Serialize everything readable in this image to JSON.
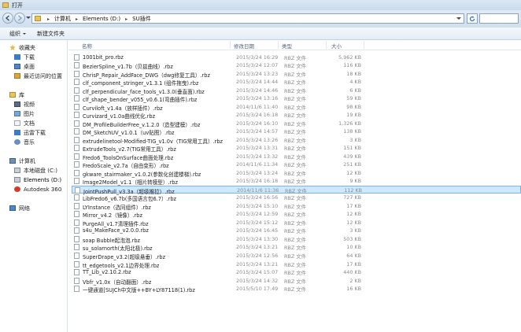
{
  "window": {
    "title": "打开"
  },
  "address": {
    "breadcrumb": [
      "计算机",
      "Elements (D:)",
      "SU插件"
    ]
  },
  "toolbar": {
    "organize": "组织",
    "new_folder": "新建文件夹"
  },
  "sidebar": {
    "favorites": {
      "label": "收藏夹",
      "items": [
        "下载",
        "桌面",
        "最近访问的位置"
      ]
    },
    "libraries": {
      "label": "库",
      "items": [
        "视频",
        "图片",
        "文档",
        "迅雷下载",
        "音乐"
      ]
    },
    "computer": {
      "label": "计算机",
      "items": [
        "本地磁盘 (C:)",
        "Elements (D:)",
        "Autodesk 360"
      ]
    },
    "network": {
      "label": "网络"
    }
  },
  "columns": {
    "name": "名称",
    "modified": "修改日期",
    "type": "类型",
    "size": "大小"
  },
  "files": [
    {
      "name": "1001bit_pro.rbz",
      "modified": "2015/3/24 16:29",
      "type": "RBZ 文件",
      "size": "5,962 KB"
    },
    {
      "name": "BezierSpline_v1.7b（贝兹曲线）.rbz",
      "modified": "2015/3/24 12:07",
      "type": "RBZ 文件",
      "size": "116 KB"
    },
    {
      "name": "ChrisP_Repair_AddFace_DWG（dwg修复工具）.rbz",
      "modified": "2015/3/24 13:23",
      "type": "RBZ 文件",
      "size": "18 KB"
    },
    {
      "name": "clf_component_stringer_v1.3.1 (组件拖曳).rbz",
      "modified": "2015/3/24 14:44",
      "type": "RBZ 文件",
      "size": "4 KB"
    },
    {
      "name": "clf_perpendicular_face_tools_v1.3.0(垂直面).rbz",
      "modified": "2015/3/24 14:46",
      "type": "RBZ 文件",
      "size": "6 KB"
    },
    {
      "name": "clf_shape_bender_v055_v0.6.1(弯曲插件).rbz",
      "modified": "2015/3/24 13:16",
      "type": "RBZ 文件",
      "size": "59 KB"
    },
    {
      "name": "Curviloft_v1.4a（放样插件）.rbz",
      "modified": "2014/11/6 11:40",
      "type": "RBZ 文件",
      "size": "98 KB"
    },
    {
      "name": "Curvizard_v1.0a曲线优化.rbz",
      "modified": "2015/3/24 16:18",
      "type": "RBZ 文件",
      "size": "19 KB"
    },
    {
      "name": "DM_ProfileBuilderFree_v.1.2.0（造型建模）.rbz",
      "modified": "2015/3/24 16:10",
      "type": "RBZ 文件",
      "size": "1,326 KB"
    },
    {
      "name": "DM_SketchUV_v1.0.1（uv贴图）.rbz",
      "modified": "2015/3/24 14:57",
      "type": "RBZ 文件",
      "size": "138 KB"
    },
    {
      "name": "extrudelinetool-Modified-TIG_v1.0v（TIG常用工具）.rbz",
      "modified": "2015/3/24 13:26",
      "type": "RBZ 文件",
      "size": "3 KB"
    },
    {
      "name": "ExtrudeTools_v2.7(TIG常用工具）.rbz",
      "modified": "2015/3/24 13:31",
      "type": "RBZ 文件",
      "size": "151 KB"
    },
    {
      "name": "Fredo6_ToolsOnSurface曲面处理.rbz",
      "modified": "2015/3/24 13:32",
      "type": "RBZ 文件",
      "size": "439 KB"
    },
    {
      "name": "FredoScale_v2.7a（自由变形）.rbz",
      "modified": "2014/11/6 11:34",
      "type": "RBZ 文件",
      "size": "251 KB"
    },
    {
      "name": "gkware_stairmaker_v1.0.2(参数化创建楼梯).rbz",
      "modified": "2015/3/24 13:24",
      "type": "RBZ 文件",
      "size": "12 KB"
    },
    {
      "name": "Image2Model_v1.1（相片转模型）.rbz",
      "modified": "2015/3/24 16:18",
      "type": "RBZ 文件",
      "size": "9 KB"
    },
    {
      "name": "JointPushPull_v3.3a（超级推拉）.rbz",
      "modified": "2014/11/6 11:36",
      "type": "RBZ 文件",
      "size": "112 KB",
      "selected": true
    },
    {
      "name": "LibFredo6_v6.7b(多国语言包6.7）.rbz",
      "modified": "2015/3/24 16:56",
      "type": "RBZ 文件",
      "size": "727 KB"
    },
    {
      "name": "LYInstance（选同组件）.rbz",
      "modified": "2015/3/24 15:10",
      "type": "RBZ 文件",
      "size": "17 KB"
    },
    {
      "name": "Mirror_v4.2（镜像）.rbz",
      "modified": "2015/3/24 12:59",
      "type": "RBZ 文件",
      "size": "12 KB"
    },
    {
      "name": "PurgeAll_v1.7清理插件.rbz",
      "modified": "2015/3/24 15:12",
      "type": "RBZ 文件",
      "size": "12 KB"
    },
    {
      "name": "s4u_MakeFace_v2.0.0.rbz",
      "modified": "2015/3/24 16:45",
      "type": "RBZ 文件",
      "size": "3 KB"
    },
    {
      "name": "soap Bubble起泡泡.rbz",
      "modified": "2015/3/24 13:30",
      "type": "RBZ 文件",
      "size": "503 KB"
    },
    {
      "name": "su_solarnorth(太阳北极).rbz",
      "modified": "2015/3/24 13:21",
      "type": "RBZ 文件",
      "size": "10 KB"
    },
    {
      "name": "SuperDrape_v3.2(超级悬垂）.rbz",
      "modified": "2015/3/24 12:56",
      "type": "RBZ 文件",
      "size": "64 KB"
    },
    {
      "name": "tt_edgetools_v2.1边界处理.rbz",
      "modified": "2015/3/24 13:21",
      "type": "RBZ 文件",
      "size": "17 KB"
    },
    {
      "name": "TT_Lib_v2.10.2.rbz",
      "modified": "2015/3/24 15:07",
      "type": "RBZ 文件",
      "size": "440 KB"
    },
    {
      "name": "Vbfr_v1.0x（自动翻面）.rbz",
      "modified": "2015/3/24 14:32",
      "type": "RBZ 文件",
      "size": "2 KB"
    },
    {
      "name": "一键通道[SUJCh中文版++BY+LY87118(1).rbz",
      "modified": "2015/5/10 17:49",
      "type": "RBZ 文件",
      "size": "16 KB"
    }
  ],
  "colors": {
    "accent": "#cde8ff",
    "selected_border": "#7eb4ea",
    "chrome": "#dbe7f4"
  }
}
